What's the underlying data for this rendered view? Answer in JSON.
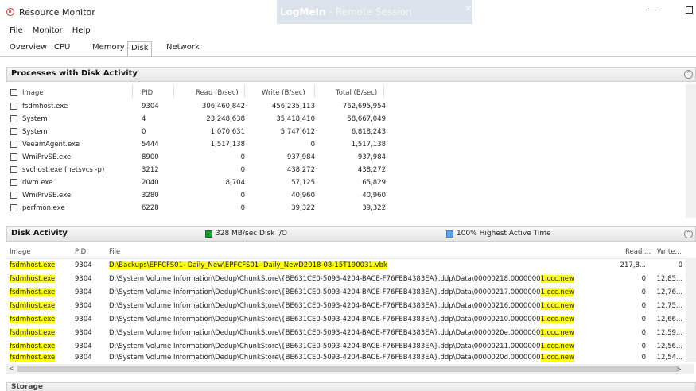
{
  "window": {
    "title": "Resource Monitor",
    "overlay_brand": "LogMeIn",
    "overlay_text": "- Remote Session",
    "overlay_close": "×"
  },
  "menu": [
    "File",
    "Monitor",
    "Help"
  ],
  "tabs": [
    {
      "label": "Overview",
      "active": false
    },
    {
      "label": "CPU",
      "active": false
    },
    {
      "label": "Memory",
      "active": false
    },
    {
      "label": "Disk",
      "active": true
    },
    {
      "label": "Network",
      "active": false
    }
  ],
  "processes": {
    "title": "Processes with Disk Activity",
    "collapse_glyph": "^",
    "columns": [
      "Image",
      "PID",
      "Read (B/sec)",
      "Write (B/sec)",
      "Total (B/sec)"
    ],
    "rows": [
      {
        "image": "fsdmhost.exe",
        "pid": "9304",
        "read": "306,460,842",
        "write": "456,235,113",
        "total": "762,695,954"
      },
      {
        "image": "System",
        "pid": "4",
        "read": "23,248,638",
        "write": "35,418,410",
        "total": "58,667,049"
      },
      {
        "image": "System",
        "pid": "0",
        "read": "1,070,631",
        "write": "5,747,612",
        "total": "6,818,243"
      },
      {
        "image": "VeeamAgent.exe",
        "pid": "5444",
        "read": "1,517,138",
        "write": "0",
        "total": "1,517,138"
      },
      {
        "image": "WmiPrvSE.exe",
        "pid": "8900",
        "read": "0",
        "write": "937,984",
        "total": "937,984"
      },
      {
        "image": "svchost.exe (netsvcs -p)",
        "pid": "3212",
        "read": "0",
        "write": "438,272",
        "total": "438,272"
      },
      {
        "image": "dwm.exe",
        "pid": "2040",
        "read": "8,704",
        "write": "57,125",
        "total": "65,829"
      },
      {
        "image": "WmiPrvSE.exe",
        "pid": "3280",
        "read": "0",
        "write": "40,960",
        "total": "40,960"
      },
      {
        "image": "perfmon.exe",
        "pid": "6228",
        "read": "0",
        "write": "39,322",
        "total": "39,322"
      }
    ]
  },
  "disk_activity": {
    "title": "Disk Activity",
    "collapse_glyph": "^",
    "legend_io": "328 MB/sec Disk I/O",
    "legend_active": "100% Highest Active Time",
    "legend_io_color": "#1f9b3a",
    "legend_active_color": "#5aa0e6",
    "columns": [
      "Image",
      "PID",
      "File",
      "Read ...",
      "Write..."
    ],
    "rows": [
      {
        "image": "fsdmhost.exe",
        "pid": "9304",
        "file": "D:\\Backups\\EPFCFS01- Daily_New\\EPFCFS01- Daily_NewD2018-08-15T190031.vbk",
        "file_tail": "",
        "read": "217,8...",
        "write": "0"
      },
      {
        "image": "fsdmhost.exe",
        "pid": "9304",
        "file": "D:\\System Volume Information\\Dedup\\ChunkStore\\{BE631CE0-5093-4204-BACE-F76FEB4383EA}.ddp\\Data\\00000218.0000000",
        "file_tail": "1.ccc.new",
        "read": "0",
        "write": "12,85..."
      },
      {
        "image": "fsdmhost.exe",
        "pid": "9304",
        "file": "D:\\System Volume Information\\Dedup\\ChunkStore\\{BE631CE0-5093-4204-BACE-F76FEB4383EA}.ddp\\Data\\00000217.0000000",
        "file_tail": "1.ccc.new",
        "read": "0",
        "write": "12,76..."
      },
      {
        "image": "fsdmhost.exe",
        "pid": "9304",
        "file": "D:\\System Volume Information\\Dedup\\ChunkStore\\{BE631CE0-5093-4204-BACE-F76FEB4383EA}.ddp\\Data\\00000216.0000000",
        "file_tail": "1.ccc.new",
        "read": "0",
        "write": "12,75..."
      },
      {
        "image": "fsdmhost.exe",
        "pid": "9304",
        "file": "D:\\System Volume Information\\Dedup\\ChunkStore\\{BE631CE0-5093-4204-BACE-F76FEB4383EA}.ddp\\Data\\00000210.0000000",
        "file_tail": "1.ccc.new",
        "read": "0",
        "write": "12,66..."
      },
      {
        "image": "fsdmhost.exe",
        "pid": "9304",
        "file": "D:\\System Volume Information\\Dedup\\ChunkStore\\{BE631CE0-5093-4204-BACE-F76FEB4383EA}.ddp\\Data\\0000020e.0000000",
        "file_tail": "1.ccc.new",
        "read": "0",
        "write": "12,59..."
      },
      {
        "image": "fsdmhost.exe",
        "pid": "9304",
        "file": "D:\\System Volume Information\\Dedup\\ChunkStore\\{BE631CE0-5093-4204-BACE-F76FEB4383EA}.ddp\\Data\\00000211.0000000",
        "file_tail": "1.ccc.new",
        "read": "0",
        "write": "12,56..."
      },
      {
        "image": "fsdmhost.exe",
        "pid": "9304",
        "file": "D:\\System Volume Information\\Dedup\\ChunkStore\\{BE631CE0-5093-4204-BACE-F76FEB4383EA}.ddp\\Data\\0000020d.0000000",
        "file_tail": "1.ccc.new",
        "read": "0",
        "write": "12,54..."
      }
    ],
    "highlight_color": "#ffff1a"
  },
  "scroll": {
    "left_arrow": "<",
    "right_arrow": ">"
  },
  "storage": {
    "title": "Storage"
  }
}
